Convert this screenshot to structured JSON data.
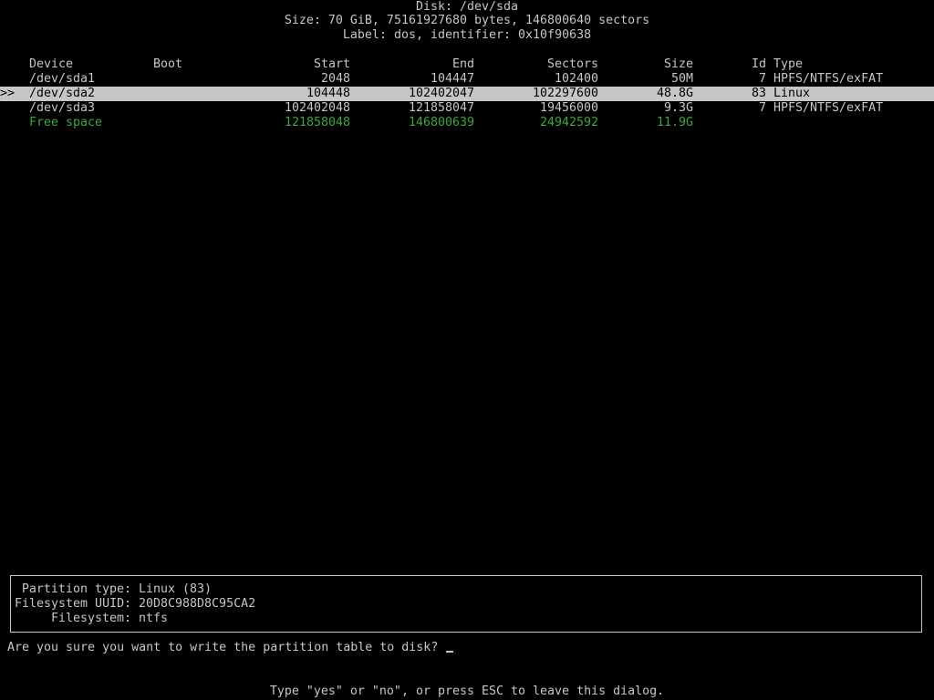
{
  "header": {
    "disk": "Disk: /dev/sda",
    "size": "Size: 70 GiB, 75161927680 bytes, 146800640 sectors",
    "label": "Label: dos, identifier: 0x10f90638"
  },
  "table": {
    "columns": {
      "device": "Device",
      "boot": "Boot",
      "start": "Start",
      "end": "End",
      "sectors": "Sectors",
      "size": "Size",
      "id": "Id",
      "type": "Type"
    },
    "selected_marker": ">>",
    "rows": [
      {
        "device": "/dev/sda1",
        "boot": "",
        "start": "2048",
        "end": "104447",
        "sectors": "102400",
        "size": "50M",
        "id": "7",
        "type": "HPFS/NTFS/exFAT"
      },
      {
        "device": "/dev/sda2",
        "boot": "",
        "start": "104448",
        "end": "102402047",
        "sectors": "102297600",
        "size": "48.8G",
        "id": "83",
        "type": "Linux"
      },
      {
        "device": "/dev/sda3",
        "boot": "",
        "start": "102402048",
        "end": "121858047",
        "sectors": "19456000",
        "size": "9.3G",
        "id": "7",
        "type": "HPFS/NTFS/exFAT"
      },
      {
        "device": "Free space",
        "boot": "",
        "start": "121858048",
        "end": "146800639",
        "sectors": "24942592",
        "size": "11.9G",
        "id": "",
        "type": ""
      }
    ]
  },
  "info": {
    "partition_type_label": "Partition type:",
    "partition_type_value": "Linux (83)",
    "uuid_label": "Filesystem UUID:",
    "uuid_value": "20D8C988D8C95CA2",
    "filesystem_label": "Filesystem:",
    "filesystem_value": "ntfs"
  },
  "prompt": {
    "question": "Are you sure you want to write the partition table to disk?",
    "input_value": "",
    "hint": "Type \"yes\" or \"no\", or press ESC to leave this dialog."
  },
  "colors": {
    "foreground": "#c6c6c6",
    "background": "#000000",
    "free_space": "#3ea63e",
    "selection_bg": "#c6c6c6"
  }
}
